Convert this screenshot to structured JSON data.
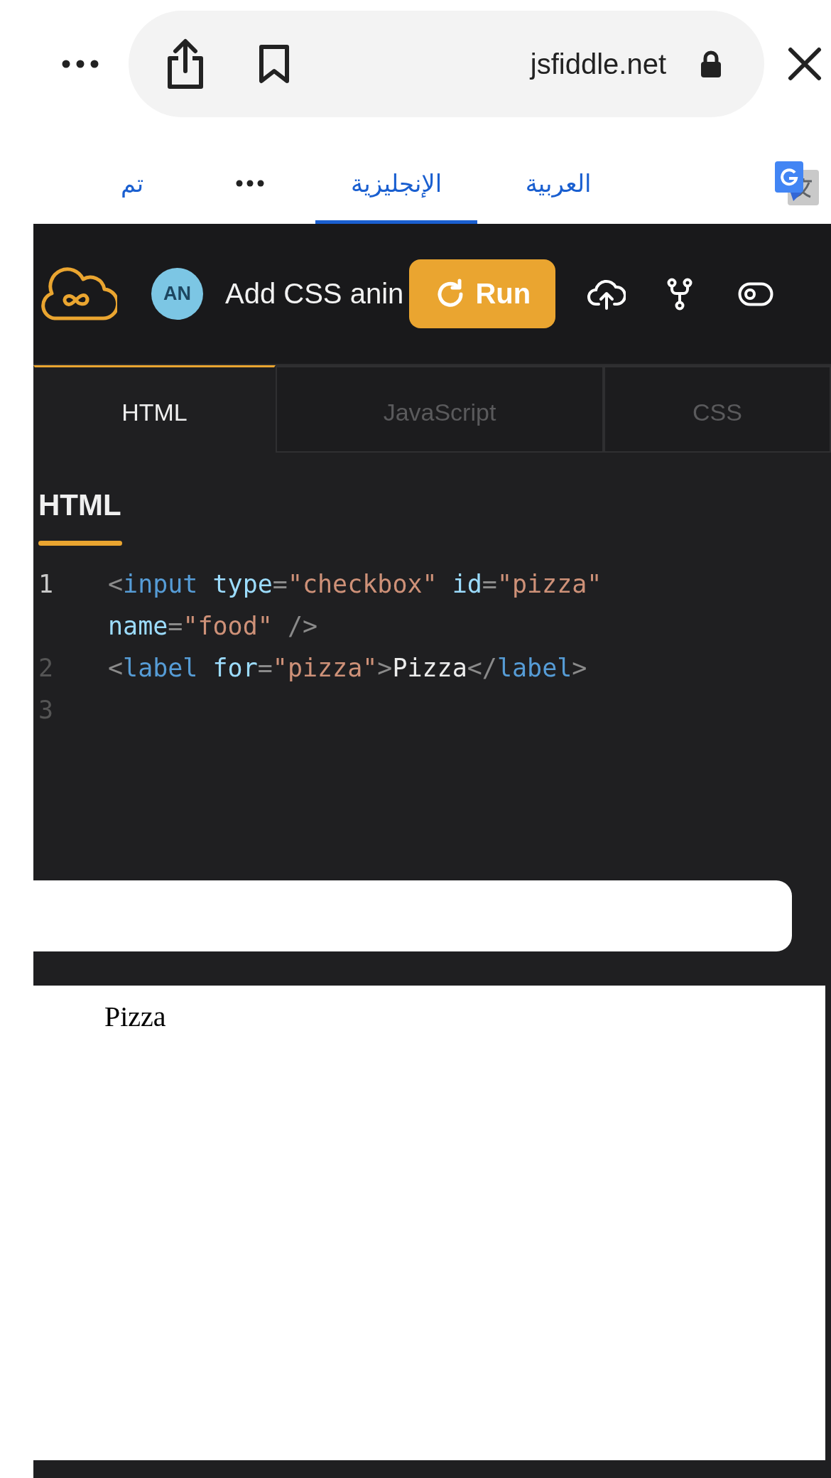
{
  "browser": {
    "url": "jsfiddle.net",
    "secure": true
  },
  "translate": {
    "done": "تم",
    "languages": [
      {
        "label": "العربية",
        "selected": false
      },
      {
        "label": "الإنجليزية",
        "selected": true
      }
    ]
  },
  "fiddle": {
    "avatar": "AN",
    "title": "Add CSS anin",
    "run": "Run",
    "tabs": [
      {
        "label": "HTML",
        "selected": true
      },
      {
        "label": "JavaScript",
        "selected": false
      },
      {
        "label": "CSS",
        "selected": false
      }
    ],
    "pane_title": "HTML",
    "lines": [
      {
        "number": "1",
        "active": true,
        "tokens": [
          {
            "kind": "punct",
            "text": "<"
          },
          {
            "kind": "tag",
            "text": "input"
          },
          {
            "kind": "attr",
            "text": " type"
          },
          {
            "kind": "punct",
            "text": "="
          },
          {
            "kind": "string",
            "text": "\"checkbox\""
          },
          {
            "kind": "attr",
            "text": " id"
          },
          {
            "kind": "punct",
            "text": "="
          },
          {
            "kind": "string",
            "text": "\"pizza\""
          },
          {
            "kind": "attr",
            "text": " name"
          },
          {
            "kind": "punct",
            "text": "="
          },
          {
            "kind": "string",
            "text": "\"food\""
          },
          {
            "kind": "punct",
            "text": " />"
          }
        ]
      },
      {
        "number": "2",
        "active": false,
        "tokens": [
          {
            "kind": "punct",
            "text": "<"
          },
          {
            "kind": "tag",
            "text": "label"
          },
          {
            "kind": "attr",
            "text": " for"
          },
          {
            "kind": "punct",
            "text": "="
          },
          {
            "kind": "string",
            "text": "\"pizza\""
          },
          {
            "kind": "punct",
            "text": ">"
          },
          {
            "kind": "plain",
            "text": "Pizza"
          },
          {
            "kind": "punct",
            "text": "</"
          },
          {
            "kind": "tag",
            "text": "label"
          },
          {
            "kind": "punct",
            "text": ">"
          }
        ]
      },
      {
        "number": "3",
        "active": false
      }
    ],
    "result": {
      "label": "Pizza"
    }
  }
}
